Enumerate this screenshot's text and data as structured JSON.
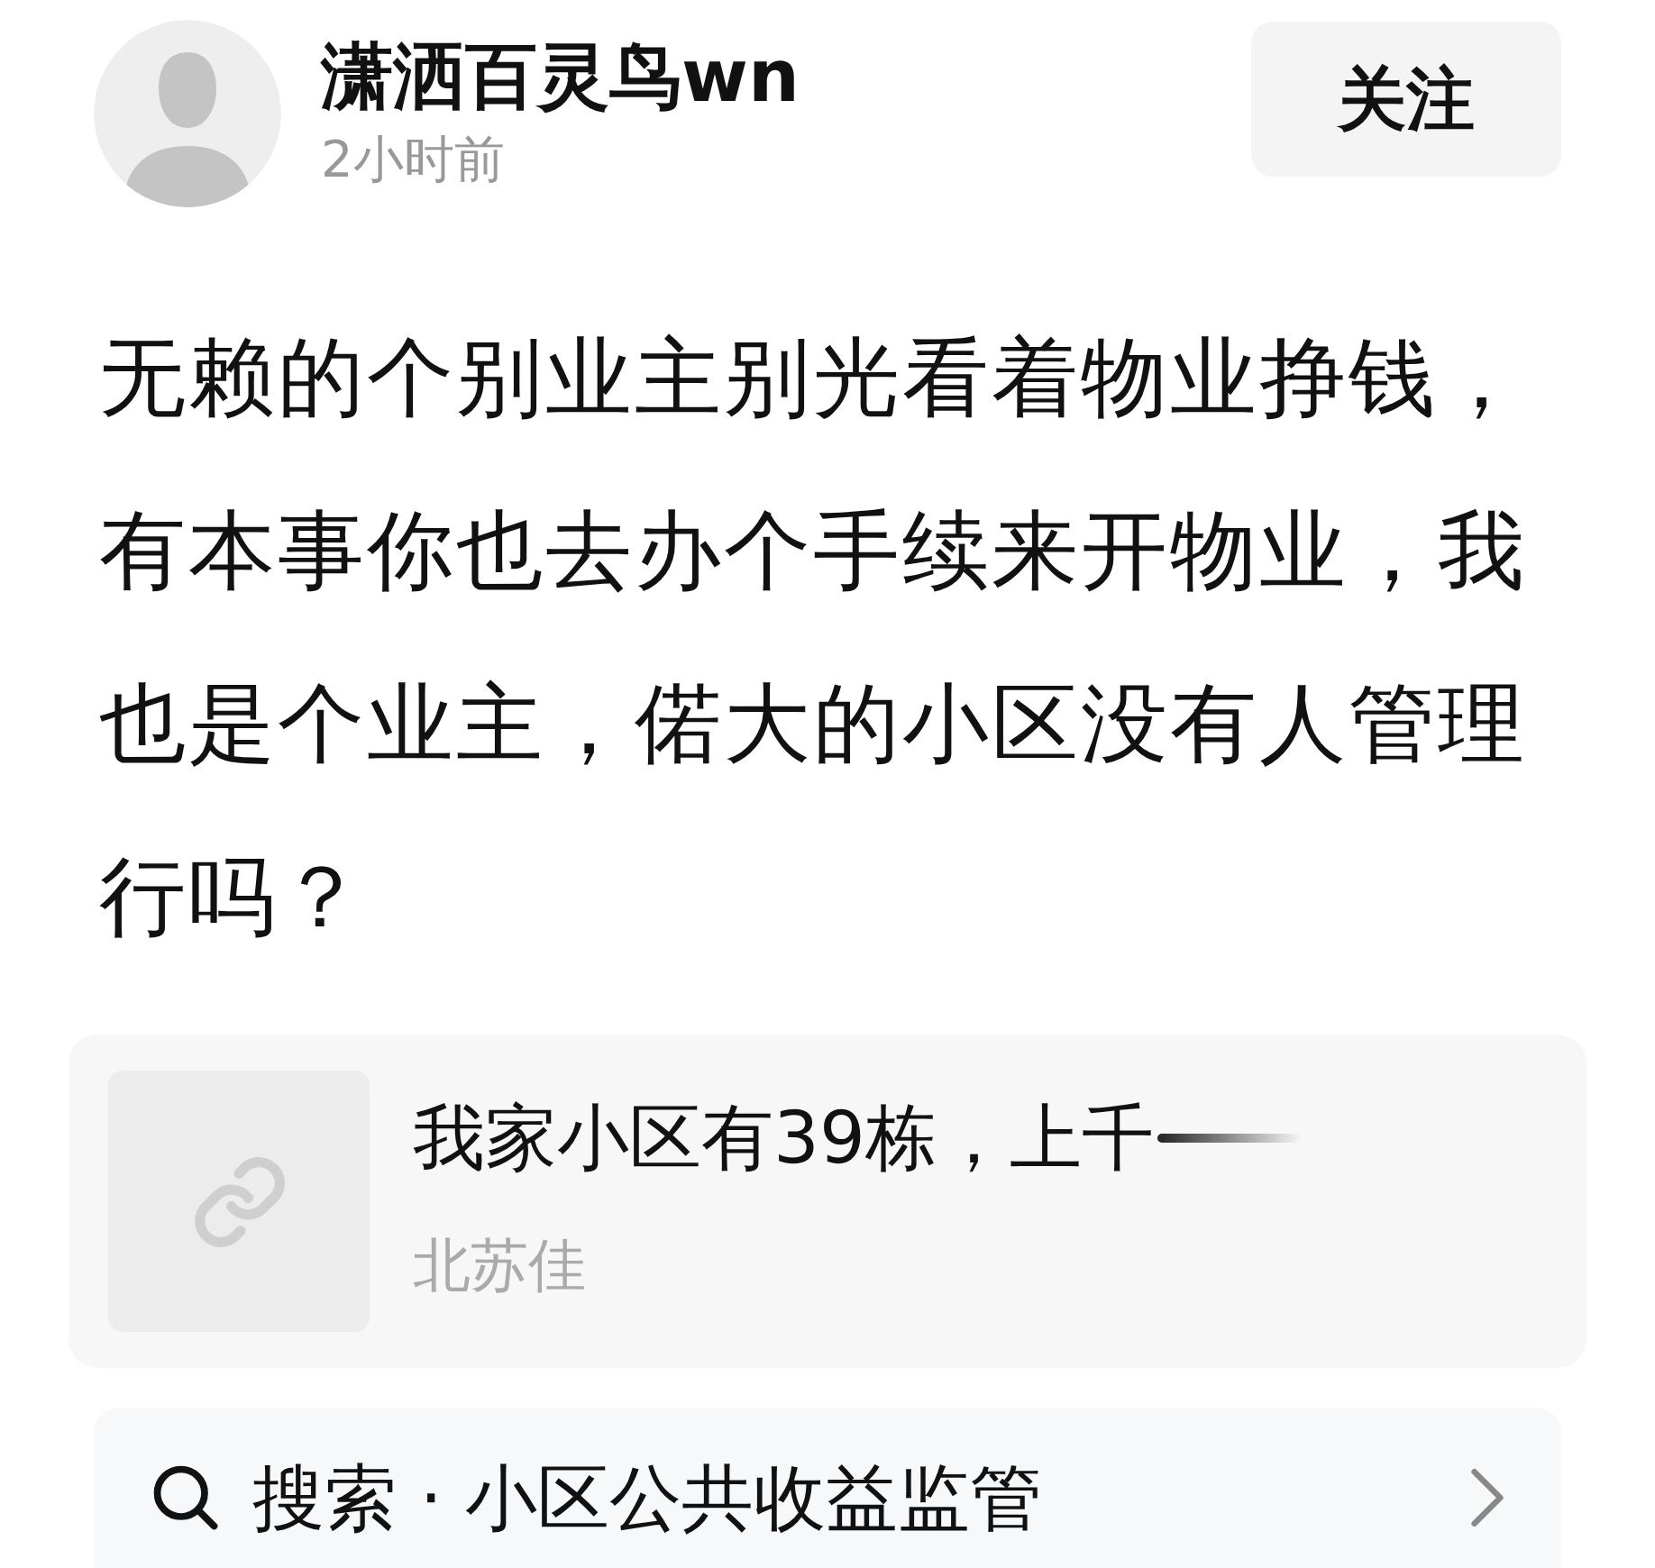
{
  "post": {
    "author": "潇洒百灵鸟wn",
    "time": "2小时前",
    "follow_button": "关注",
    "text": "无赖的个别业主别光看着物业挣钱，有本事你也去办个手续来开物业，我也是个业主，偌大的小区没有人管理行吗？"
  },
  "link_card": {
    "title": "我家小区有39栋，上千",
    "source": "北苏佳"
  },
  "search_bar": {
    "label": "搜索 · 小区公共收益监管"
  }
}
